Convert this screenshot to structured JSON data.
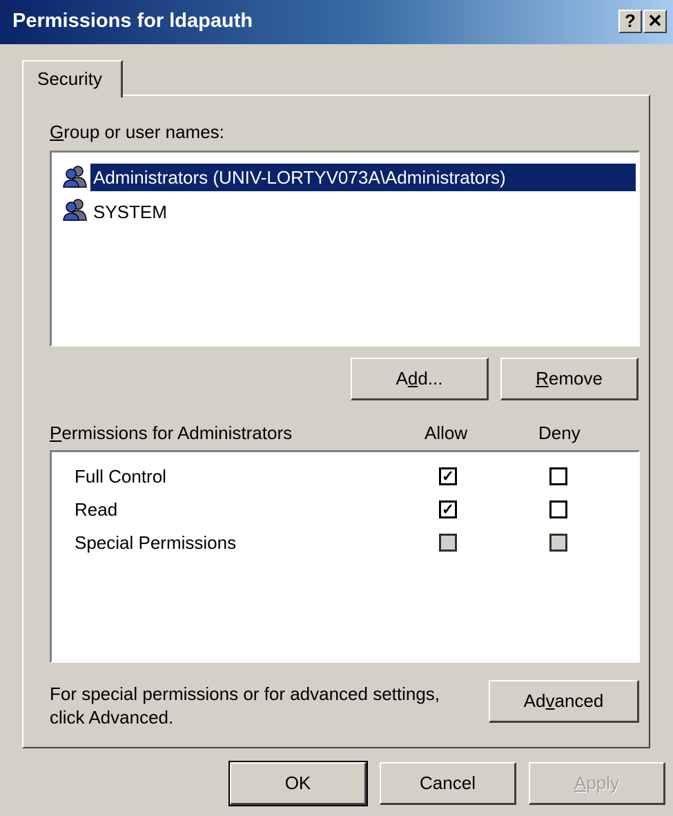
{
  "window": {
    "title": "Permissions for ldapauth",
    "help": "?",
    "close": "✕"
  },
  "tabs": [
    {
      "label": "Security"
    }
  ],
  "group_label": "Group or user names:",
  "users": [
    {
      "name": "Administrators (UNIV-LORTYV073A\\Administrators)",
      "selected": true,
      "icon": "group-icon"
    },
    {
      "name": "SYSTEM",
      "selected": false,
      "icon": "group-icon"
    }
  ],
  "buttons": {
    "add": "Add...",
    "remove": "Remove",
    "advanced": "Advanced",
    "ok": "OK",
    "cancel": "Cancel",
    "apply": "Apply"
  },
  "permissions": {
    "header": "Permissions for Administrators",
    "allow": "Allow",
    "deny": "Deny",
    "rows": [
      {
        "name": "Full Control",
        "allow": "checked",
        "deny": "unchecked"
      },
      {
        "name": "Read",
        "allow": "checked",
        "deny": "unchecked"
      },
      {
        "name": "Special Permissions",
        "allow": "grayed",
        "deny": "grayed"
      }
    ]
  },
  "advanced_text_line1": "For special permissions or for advanced settings,",
  "advanced_text_line2": "click Advanced.",
  "colors": {
    "title_start": "#0a246a",
    "title_end": "#a6caf0",
    "selection": "#0a246a",
    "face": "#d4d0c8"
  }
}
